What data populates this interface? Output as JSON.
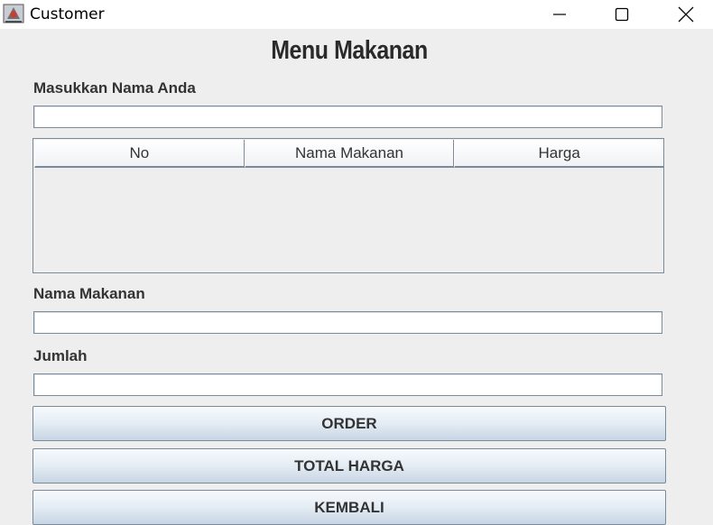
{
  "window": {
    "title": "Customer",
    "icon": "java-app-icon",
    "controls": [
      "minimize-icon",
      "maximize-icon",
      "close-icon"
    ]
  },
  "page": {
    "title": "Menu Makanan"
  },
  "form": {
    "name_label": "Masukkan Nama Anda",
    "name_value": "",
    "food_label": "Nama Makanan",
    "food_value": "",
    "qty_label": "Jumlah",
    "qty_value": ""
  },
  "table": {
    "columns": [
      "No",
      "Nama Makanan",
      "Harga"
    ],
    "rows": []
  },
  "buttons": {
    "order": "ORDER",
    "total": "TOTAL HARGA",
    "back": "KEMBALI"
  }
}
